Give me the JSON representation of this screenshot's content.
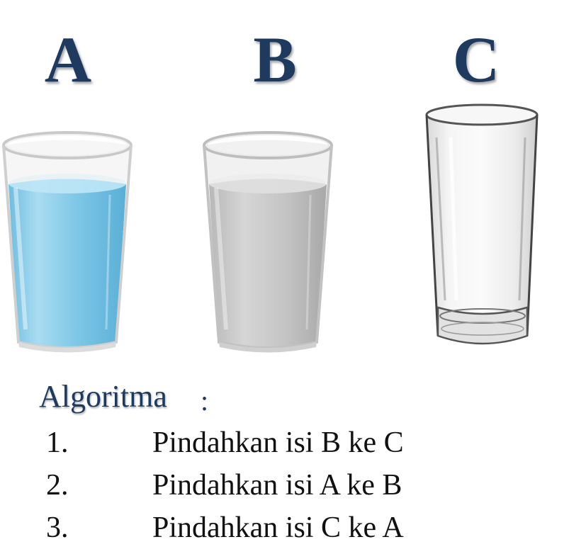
{
  "glasses": [
    {
      "label": "A",
      "contents": "blue water",
      "color": "#7cc6e6"
    },
    {
      "label": "B",
      "contents": "grey liquid",
      "color": "#c4c4c4"
    },
    {
      "label": "C",
      "contents": "empty",
      "color": "#f2f2f2"
    }
  ],
  "algorithm": {
    "title": "Algoritma",
    "colon": ":",
    "steps": [
      {
        "number": "1.",
        "text": "Pindahkan isi B ke C"
      },
      {
        "number": "2.",
        "text": "Pindahkan isi A ke B"
      },
      {
        "number": "3.",
        "text": "Pindahkan isi C ke A"
      }
    ]
  }
}
